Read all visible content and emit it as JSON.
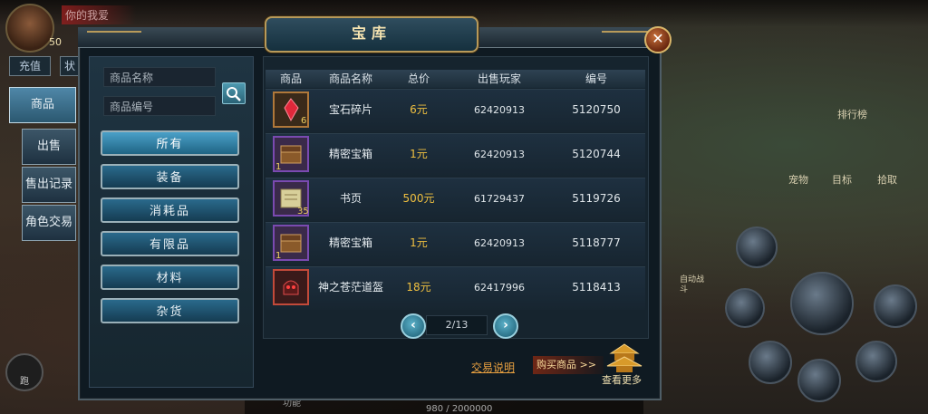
{
  "background": {
    "top_name": "你的我爱",
    "level": "50",
    "recharge": "充值",
    "recharge2": "状",
    "run": "跑",
    "func": "功能",
    "exp": "980 / 2000000",
    "right_labels": [
      "排行榜",
      "宠物",
      "目标",
      "拾取",
      "自动战斗"
    ]
  },
  "sidebar": {
    "items": [
      {
        "label": "商品",
        "active": true
      },
      {
        "label": "出售"
      },
      {
        "label": "售出记录"
      },
      {
        "label": "角色交易"
      }
    ]
  },
  "dialog": {
    "title": "宝库",
    "close_icon": "close-icon",
    "search": {
      "name_placeholder": "商品名称",
      "id_placeholder": "商品编号",
      "button_icon": "search-icon"
    },
    "categories": [
      "所有",
      "装备",
      "消耗品",
      "有限品",
      "材料",
      "杂货"
    ],
    "active_category": "所有",
    "table": {
      "headers": [
        "商品",
        "商品名称",
        "总价",
        "出售玩家",
        "编号"
      ],
      "rows": [
        {
          "icon": "red-gem-shard-icon",
          "qty": "6",
          "name": "宝石碎片",
          "price": "6元",
          "seller": "62420913",
          "id": "5120750"
        },
        {
          "icon": "treasure-chest-icon",
          "qty": "1",
          "name": "精密宝箱",
          "price": "1元",
          "seller": "62420913",
          "id": "5120744"
        },
        {
          "icon": "scroll-page-icon",
          "qty": "35",
          "name": "书页",
          "price": "500元",
          "seller": "61729437",
          "id": "5119726"
        },
        {
          "icon": "treasure-chest-icon",
          "qty": "1",
          "name": "精密宝箱",
          "price": "1元",
          "seller": "62420913",
          "id": "5118777"
        },
        {
          "icon": "demon-helmet-icon",
          "qty": "",
          "name": "神之苍茫道盔",
          "price": "18元",
          "seller": "62417996",
          "id": "5118413"
        }
      ]
    },
    "pagination": {
      "current": 2,
      "total": 13,
      "text": "2/13"
    },
    "footer": {
      "help": "交易说明",
      "buy": "购买商品 >>",
      "more": "查看更多"
    }
  }
}
